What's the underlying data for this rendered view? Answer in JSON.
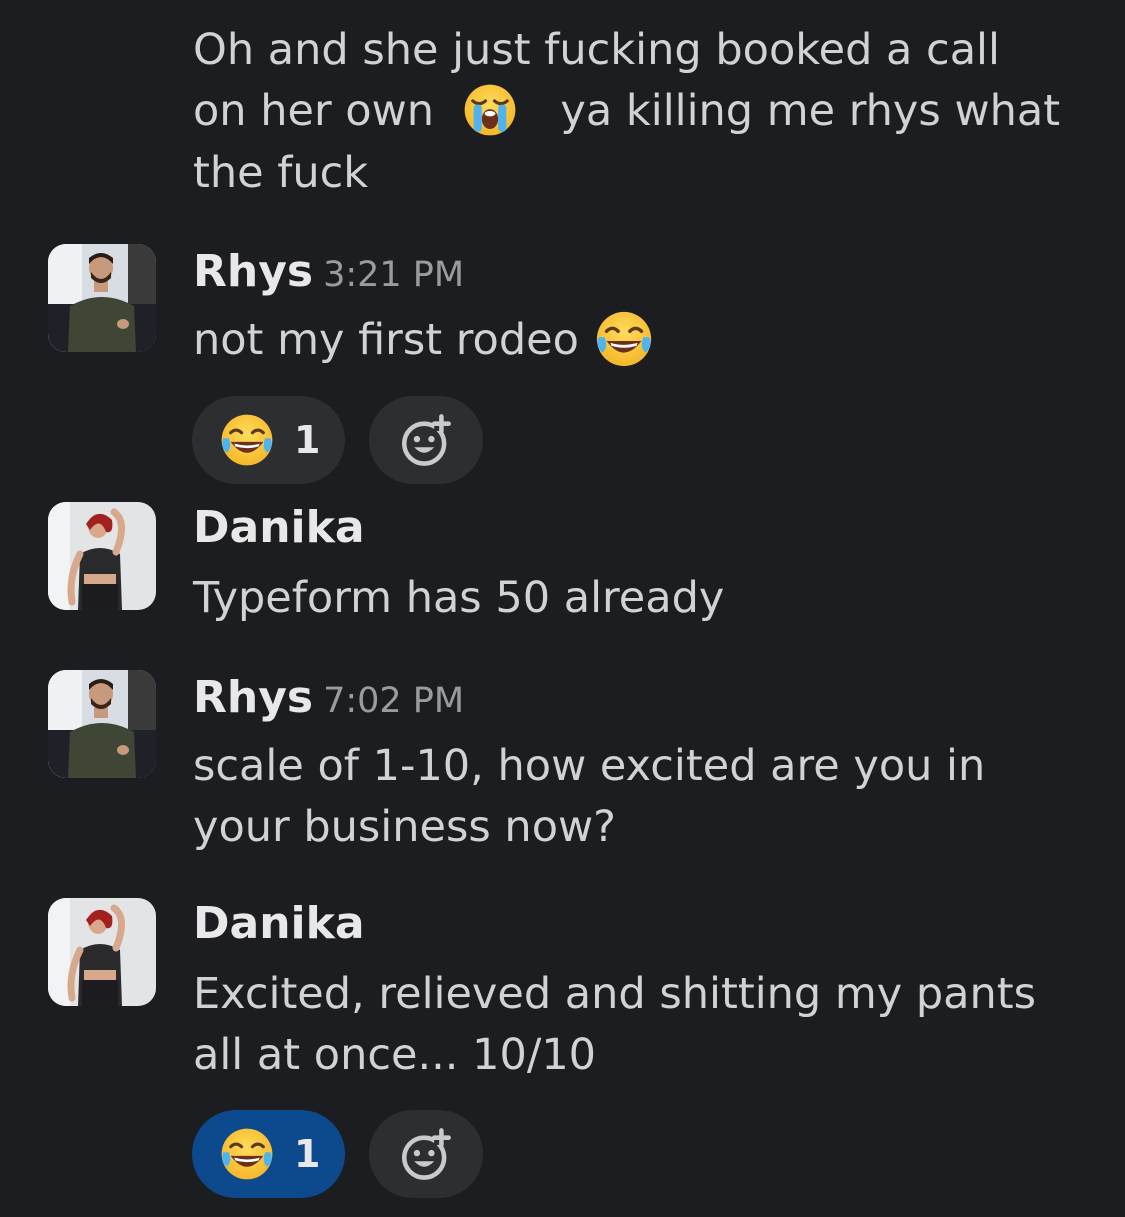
{
  "messages": [
    {
      "text_lines": [
        "Oh and she just fucking booked a call",
        "on her own",
        "ya killing me rhys what",
        "the fuck"
      ],
      "emoji": "loudly-crying-face"
    },
    {
      "author": "Rhys",
      "time": "3:21 PM",
      "text": "not my first rodeo",
      "emoji": "face-with-tears-of-joy",
      "reaction": {
        "emoji": "face-with-tears-of-joy",
        "count": "1",
        "active": false
      }
    },
    {
      "author": "Danika",
      "text": "Typeform has 50 already"
    },
    {
      "author": "Rhys",
      "time": "7:02 PM",
      "text_lines": [
        "scale of 1-10, how excited are you in",
        "your business now?"
      ]
    },
    {
      "author": "Danika",
      "text_lines": [
        "Excited, relieved and shitting my pants",
        "all at once... 10/10"
      ],
      "reaction": {
        "emoji": "face-with-tears-of-joy",
        "count": "1",
        "active": true
      }
    }
  ],
  "colors": {
    "background": "#1b1d21",
    "text": "#d1d2d3",
    "timestamp": "#9a9b9d",
    "reaction_bg": "#2c2e32",
    "reaction_active_bg": "#0c4a8d"
  },
  "icons": {
    "add_reaction": "add-reaction-icon"
  }
}
